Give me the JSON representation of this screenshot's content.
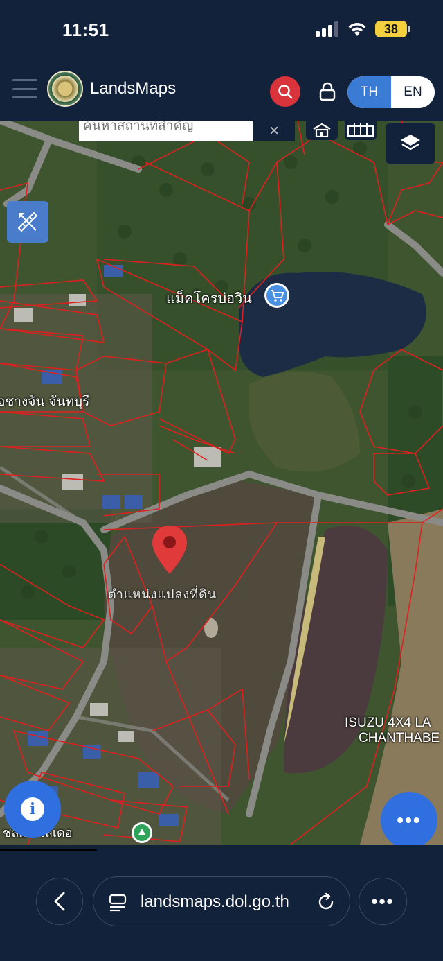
{
  "status_bar": {
    "time": "11:51",
    "battery": "38"
  },
  "header": {
    "app_name": "LandsMaps",
    "lang_th": "TH",
    "lang_en": "EN",
    "active_language": "TH"
  },
  "map": {
    "search_placeholder": "ค้นหาสถานที่สำคัญ",
    "search_clear": "×",
    "labels": {
      "poi_store": "แม็คโครบ่อวิน",
      "area_left": "อชางจัน จันทบุรี",
      "marker_caption": "ตำแหน่งแปลงที่ดิน",
      "business_line1": "ISUZU 4X4 LA",
      "business_line2": "CHANTHABE",
      "bottom_left": "ชลม สไลเดอ"
    },
    "colors": {
      "parcel_line": "#e0201e",
      "marker": "#e03a3a",
      "accent_blue": "#2f6fe0"
    }
  },
  "bottom_bar": {
    "url": "landsmaps.dol.go.th",
    "more": "•••"
  },
  "fab": {
    "info": "i",
    "more": "•••"
  }
}
